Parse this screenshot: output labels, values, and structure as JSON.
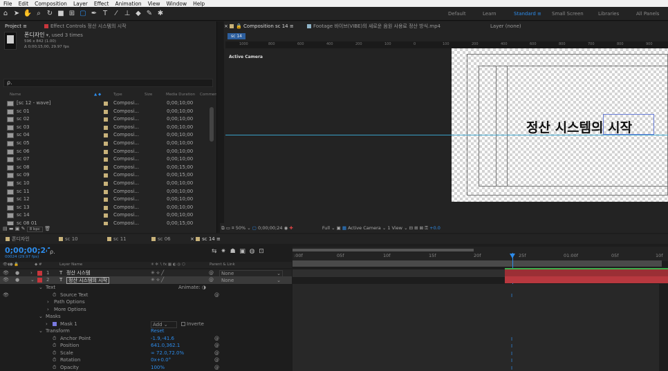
{
  "menu": [
    "File",
    "Edit",
    "Composition",
    "Layer",
    "Effect",
    "Animation",
    "View",
    "Window",
    "Help"
  ],
  "workspaces": {
    "default": "Default",
    "learn": "Learn",
    "standard": "Standard",
    "small_screen": "Small Screen",
    "libraries": "Libraries",
    "all_panels": "All Panels"
  },
  "project": {
    "tab": "Project",
    "effect_tab": "Effect Controls 정산 시스템의 시작",
    "item_name": "폰디자인",
    "used": ", used 3 times",
    "dims": "596 x 842 (1.00)",
    "duration": "Δ 0;00;15;00, 29.97 fps",
    "search_placeholder": "ρ.",
    "bpc": "8 bpc",
    "columns": {
      "name": "Name",
      "type": "Type",
      "size": "Size",
      "media_duration": "Media Duration",
      "comment": "Commen"
    },
    "rows": [
      {
        "name": "[sc 12 - wave]",
        "type": "Composi...",
        "duration": "0;00;10;00"
      },
      {
        "name": "sc 01",
        "type": "Composi...",
        "duration": "0;00;10;00"
      },
      {
        "name": "sc 02",
        "type": "Composi...",
        "duration": "0;00;10;00"
      },
      {
        "name": "sc 03",
        "type": "Composi...",
        "duration": "0;00;10;00"
      },
      {
        "name": "sc 04",
        "type": "Composi...",
        "duration": "0;00;10;00"
      },
      {
        "name": "sc 05",
        "type": "Composi...",
        "duration": "0;00;10;00"
      },
      {
        "name": "sc 06",
        "type": "Composi...",
        "duration": "0;00;10;00"
      },
      {
        "name": "sc 07",
        "type": "Composi...",
        "duration": "0;00;10;00"
      },
      {
        "name": "sc 08",
        "type": "Composi...",
        "duration": "0;00;15;00"
      },
      {
        "name": "sc 09",
        "type": "Composi...",
        "duration": "0;00;15;00"
      },
      {
        "name": "sc 10",
        "type": "Composi...",
        "duration": "0;00;10;00"
      },
      {
        "name": "sc 11",
        "type": "Composi...",
        "duration": "0;00;10;00"
      },
      {
        "name": "sc 12",
        "type": "Composi...",
        "duration": "0;00;10;00"
      },
      {
        "name": "sc 13",
        "type": "Composi...",
        "duration": "0;00;10;00"
      },
      {
        "name": "sc 14",
        "type": "Composi...",
        "duration": "0;00;10;00"
      },
      {
        "name": "sc 08 01",
        "type": "Composi...",
        "duration": "0;00;15;00"
      }
    ]
  },
  "comp": {
    "tab": "Composition sc 14",
    "footage_tab": "Footage 바이브(VIBE)의 새로운 음원 사용료 정산 방식.mp4",
    "layer_tab": "Layer (none)",
    "subtab": "sc 14",
    "active_camera": "Active Camera",
    "ruler_marks": [
      "1000",
      "800",
      "600",
      "400",
      "200",
      "100",
      "0",
      "100",
      "200",
      "400",
      "600",
      "800",
      "700",
      "800",
      "900"
    ],
    "canvas_text": "정산 시스템의 시작",
    "zoom": "50%",
    "timecode": "0;00;00;24",
    "quality": "Full",
    "camera": "Active Camera",
    "view": "1 View",
    "offset": "+0.0"
  },
  "timeline": {
    "tabs": [
      "폰디자인",
      "sc 10",
      "sc 11",
      "sc 06",
      "sc 14"
    ],
    "timecode": "0;00;00;24",
    "fps_info": "00024 (29.97 fps)",
    "search": "ρ.",
    "col_layer": "Layer Name",
    "col_parent": "Parent & Link",
    "layers": [
      {
        "num": "1",
        "name": "정산 시스템",
        "parent": "None"
      },
      {
        "num": "2",
        "name": "정산 시스템의 시작",
        "parent": "None"
      }
    ],
    "props": {
      "text": "Text",
      "animate": "Animate:",
      "source_text": "Source Text",
      "path_options": "Path Options",
      "more_options": "More Options",
      "masks": "Masks",
      "mask1": "Mask 1",
      "mask_mode": "Add",
      "inverted": "Inverte",
      "transform": "Transform",
      "reset": "Reset",
      "anchor": "Anchor Point",
      "anchor_val": "-1.9,-41.6",
      "position": "Position",
      "position_val": "641.0,362.1",
      "scale": "Scale",
      "scale_val": "∞ 72.0,72.0%",
      "rotation": "Rotation",
      "rotation_val": "0x+0.0°",
      "opacity": "Opacity",
      "opacity_val": "100%"
    },
    "ticks": [
      ":00f",
      "05f",
      "10f",
      "15f",
      "20f",
      "25f",
      "01:00f",
      "05f",
      "10f"
    ],
    "colors": {
      "accent": "#2d8ceb",
      "layer1": "#c8363c",
      "track": "#9b2f35"
    }
  }
}
